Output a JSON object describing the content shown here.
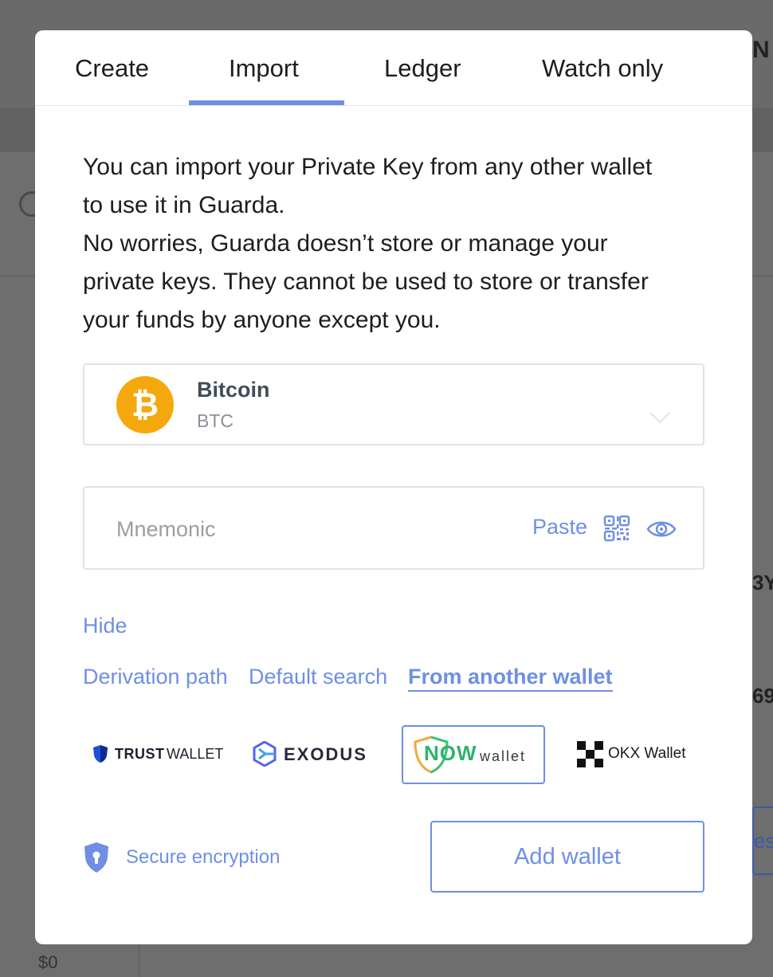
{
  "tabs": [
    {
      "label": "Create"
    },
    {
      "label": "Import"
    },
    {
      "label": "Ledger"
    },
    {
      "label": "Watch only"
    }
  ],
  "active_tab": "Import",
  "intro": {
    "line1": "You can import your Private Key from any other wallet",
    "line2": "to use it in Guarda.",
    "line3": "No worries, Guarda doesn’t store or manage your",
    "line4": "private keys. They cannot be used to store or transfer",
    "line5": "your funds by anyone except you."
  },
  "coin": {
    "name": "Bitcoin",
    "symbol": "BTC",
    "icon_glyph": "₿",
    "icon_color": "#f5a80d"
  },
  "mnemonic": {
    "placeholder": "Mnemonic",
    "value": "",
    "paste_label": "Paste"
  },
  "hide_label": "Hide",
  "options": [
    {
      "label": "Derivation path"
    },
    {
      "label": "Default search"
    },
    {
      "label": "From another wallet"
    }
  ],
  "active_option": "From another wallet",
  "wallets": [
    {
      "strong": "TRUST",
      "light": "WALLET",
      "icon": "trust-shield-icon"
    },
    {
      "label": "EXODUS",
      "icon": "exodus-icon"
    },
    {
      "strong": "NOW",
      "light": "wallet",
      "icon": "now-wallet-icon"
    },
    {
      "label": "OKX Wallet",
      "icon": "okx-icon"
    }
  ],
  "selected_wallet": "NOW wallet",
  "secure_label": "Secure encryption",
  "add_button_label": "Add wallet",
  "colors": {
    "accent": "#6f8fe3",
    "bitcoin": "#f5a80d",
    "text": "#1d1d1f"
  },
  "background": {
    "balance": "$0",
    "partial_1": "N",
    "partial_2": "3Y",
    "partial_3": "69",
    "partial_4": "es"
  }
}
